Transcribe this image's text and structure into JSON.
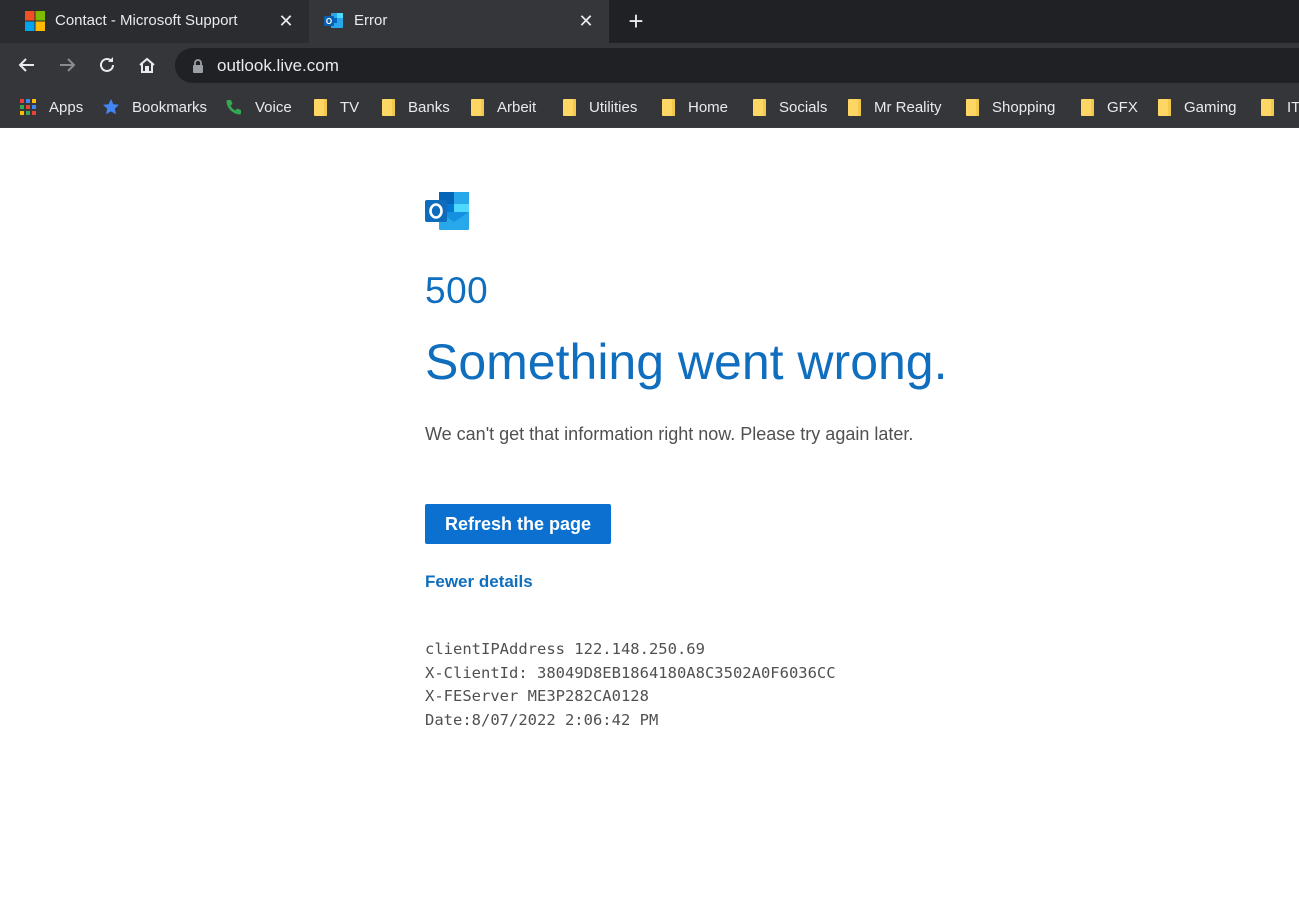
{
  "tabs": [
    {
      "title": "Contact - Microsoft Support",
      "active": false,
      "icon": "microsoft-logo-icon"
    },
    {
      "title": "Error",
      "active": true,
      "icon": "outlook-icon"
    }
  ],
  "toolbar": {
    "url": "outlook.live.com"
  },
  "bookmarks": [
    {
      "label": "Apps",
      "icon": "apps-grid-icon"
    },
    {
      "label": "Bookmarks",
      "icon": "star-icon"
    },
    {
      "label": "Voice",
      "icon": "voice-phone-icon"
    },
    {
      "label": "TV",
      "icon": "folder-icon"
    },
    {
      "label": "Banks",
      "icon": "folder-icon"
    },
    {
      "label": "Arbeit",
      "icon": "folder-icon"
    },
    {
      "label": "Utilities",
      "icon": "folder-icon"
    },
    {
      "label": "Home",
      "icon": "folder-icon"
    },
    {
      "label": "Socials",
      "icon": "folder-icon"
    },
    {
      "label": "Mr Reality",
      "icon": "folder-icon"
    },
    {
      "label": "Shopping",
      "icon": "folder-icon"
    },
    {
      "label": "GFX",
      "icon": "folder-icon"
    },
    {
      "label": "Gaming",
      "icon": "folder-icon"
    },
    {
      "label": "IT",
      "icon": "folder-icon"
    }
  ],
  "page": {
    "status_code": "500",
    "headline": "Something went wrong.",
    "message": "We can't get that information right now. Please try again later.",
    "refresh_label": "Refresh the page",
    "details_label": "Fewer details",
    "diagnostics": [
      "clientIPAddress 122.148.250.69",
      "X-ClientId: 38049D8EB1864180A8C3502A0F6036CC",
      "X-FEServer ME3P282CA0128",
      "Date:8/07/2022 2:06:42 PM"
    ]
  },
  "colors": {
    "accent": "#106ebe",
    "button": "#0b70cf",
    "chrome_dark": "#202124",
    "chrome_toolbar": "#35363a",
    "text_gray": "#505050",
    "folder": "#fdd663"
  }
}
